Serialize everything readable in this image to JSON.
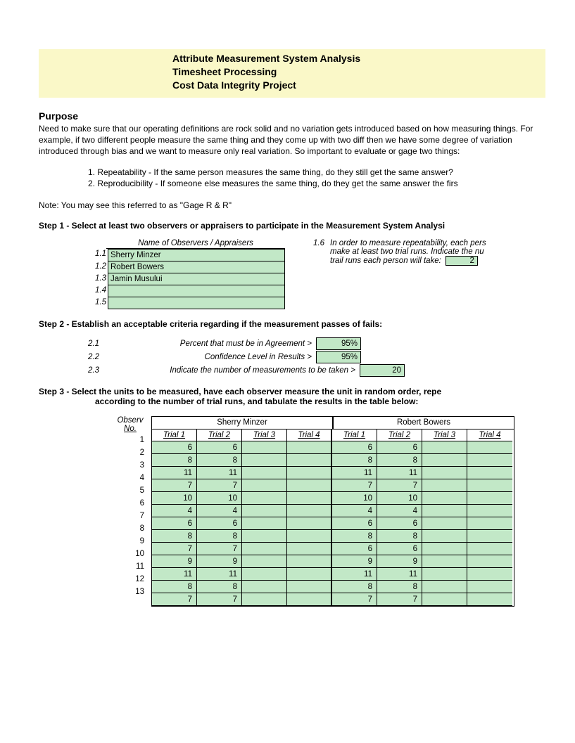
{
  "title": {
    "line1": "Attribute Measurement System Analysis",
    "line2": "Timesheet Processing",
    "line3": "Cost Data Integrity Project"
  },
  "purpose": {
    "heading": "Purpose",
    "para": "Need to make sure that our operating definitions are rock solid and no variation gets introduced based on how measuring things. For example, if two different people measure the same thing and they come up with two diff then we have some degree of variation introduced through bias and we want to measure only real variation. So important to evaluate or gage two things:",
    "bullet1": "1. Repeatability - If the same person measures the same thing, do they still get the same answer?",
    "bullet2": "2. Reproducibility - If someone else measures the same thing, do they get the same answer the firs",
    "note": "Note: You may see this referred to as \"Gage R & R\""
  },
  "step1": {
    "heading": "Step 1 - Select at least two observers or appraisers to participate in the Measurement System Analysi",
    "tableHeader": "Name of Observers / Appraisers",
    "rows": [
      {
        "num": "1.1",
        "name": "Sherry Minzer"
      },
      {
        "num": "1.2",
        "name": "Robert Bowers"
      },
      {
        "num": "1.3",
        "name": "Jamin Musului"
      },
      {
        "num": "1.4",
        "name": ""
      },
      {
        "num": "1.5",
        "name": ""
      }
    ],
    "rightNum": "1.6",
    "rightText1": "In order to measure repeatability, each pers",
    "rightText2": "make at least two trial runs. Indicate the nu",
    "rightText3": "trail runs each person will take:",
    "trialRuns": "2"
  },
  "step2": {
    "heading": "Step 2 - Establish an acceptable criteria regarding if the measurement passes of fails:",
    "rows": [
      {
        "num": "2.1",
        "label": "Percent that must be in Agreement >",
        "val": "95%"
      },
      {
        "num": "2.2",
        "label": "Confidence Level in Results >",
        "val": "95%"
      },
      {
        "num": "2.3",
        "label": "Indicate the number of measurements to be taken >",
        "val": "20"
      }
    ]
  },
  "step3": {
    "heading": "Step 3 - Select the units to be measured, have each observer measure the unit in random order, repe",
    "subheading": "according to the number of trial runs, and tabulate the results in the table below:",
    "leftHdr1": "Observ",
    "leftHdr2": "No.",
    "observers": [
      "Sherry Minzer",
      "Robert Bowers"
    ],
    "trials": [
      "Trial 1",
      "Trial 2",
      "Trial 3",
      "Trial 4"
    ],
    "data": [
      {
        "n": "1",
        "v": [
          "6",
          "6",
          "",
          "",
          "6",
          "6",
          "",
          ""
        ]
      },
      {
        "n": "2",
        "v": [
          "8",
          "8",
          "",
          "",
          "8",
          "8",
          "",
          ""
        ]
      },
      {
        "n": "3",
        "v": [
          "11",
          "11",
          "",
          "",
          "11",
          "11",
          "",
          ""
        ]
      },
      {
        "n": "4",
        "v": [
          "7",
          "7",
          "",
          "",
          "7",
          "7",
          "",
          ""
        ]
      },
      {
        "n": "5",
        "v": [
          "10",
          "10",
          "",
          "",
          "10",
          "10",
          "",
          ""
        ]
      },
      {
        "n": "6",
        "v": [
          "4",
          "4",
          "",
          "",
          "4",
          "4",
          "",
          ""
        ]
      },
      {
        "n": "7",
        "v": [
          "6",
          "6",
          "",
          "",
          "6",
          "6",
          "",
          ""
        ]
      },
      {
        "n": "8",
        "v": [
          "8",
          "8",
          "",
          "",
          "8",
          "8",
          "",
          ""
        ]
      },
      {
        "n": "9",
        "v": [
          "7",
          "7",
          "",
          "",
          "6",
          "6",
          "",
          ""
        ]
      },
      {
        "n": "10",
        "v": [
          "9",
          "9",
          "",
          "",
          "9",
          "9",
          "",
          ""
        ]
      },
      {
        "n": "11",
        "v": [
          "11",
          "11",
          "",
          "",
          "11",
          "11",
          "",
          ""
        ]
      },
      {
        "n": "12",
        "v": [
          "8",
          "8",
          "",
          "",
          "8",
          "8",
          "",
          ""
        ]
      },
      {
        "n": "13",
        "v": [
          "7",
          "7",
          "",
          "",
          "7",
          "7",
          "",
          ""
        ]
      }
    ]
  }
}
